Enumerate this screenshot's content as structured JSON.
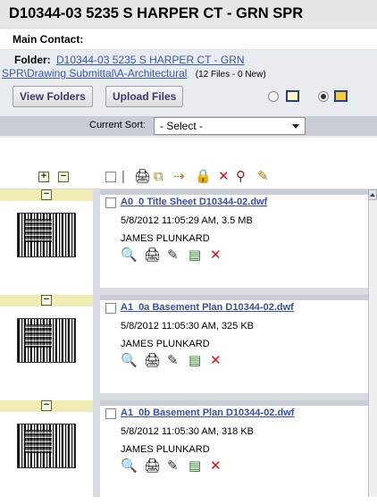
{
  "header": {
    "title": "D10344-03 5235 S HARPER CT - GRN SPR"
  },
  "main_contact": {
    "label": "Main Contact:"
  },
  "folder": {
    "label": "Folder:",
    "path_line1": "D10344-03 5235 S HARPER CT - GRN",
    "path_line2": "SPR\\Drawing Submittal\\A-Architectural",
    "count": "(12 Files - 0 New)"
  },
  "buttons": {
    "view_folders": "View Folders",
    "upload_files": "Upload Files"
  },
  "sort": {
    "label": "Current Sort:",
    "selected": "- Select -"
  },
  "colors": {
    "link": "#3a4fa4",
    "delete": "#d4121d",
    "thumb_header": "#f1ebb4"
  },
  "files": [
    {
      "name": "A0_0 Title Sheet D10344-02.dwf",
      "meta": "5/8/2012 11:05:29 AM, 3.5 MB",
      "user": "JAMES PLUNKARD"
    },
    {
      "name": "A1_0a Basement Plan D10344-02.dwf",
      "meta": "5/8/2012 11:05:30 AM, 325 KB",
      "user": "JAMES PLUNKARD"
    },
    {
      "name": "A1_0b Basement Plan D10344-02.dwf",
      "meta": "5/8/2012 11:05:30 AM, 318 KB",
      "user": "JAMES PLUNKARD"
    }
  ],
  "icons": {
    "expand": "+",
    "collapse": "−",
    "toolbar": [
      "print-icon",
      "copy-icon",
      "move-icon",
      "lock-icon",
      "delete-icon",
      "stamp-icon",
      "edit-icon"
    ],
    "row_actions": [
      "view-icon",
      "print-icon",
      "edit-icon",
      "properties-icon",
      "delete-icon"
    ]
  }
}
